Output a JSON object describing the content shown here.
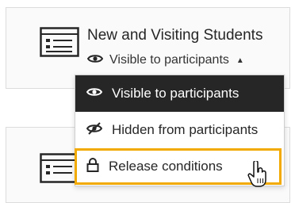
{
  "cards": [
    {
      "title": "New and Visiting Students",
      "visibility_label": "Visible to participants",
      "caret": "▲"
    }
  ],
  "menu": {
    "items": [
      {
        "label": "Visible to participants",
        "state": "selected",
        "icon": "eye-icon"
      },
      {
        "label": "Hidden from participants",
        "state": "normal",
        "icon": "eye-slash-icon"
      },
      {
        "label": "Release conditions",
        "state": "hovered",
        "icon": "lock-icon"
      }
    ]
  },
  "colors": {
    "selected_bg": "#262626",
    "focus_outline": "#f2a900",
    "card_bg": "#fafafa"
  }
}
